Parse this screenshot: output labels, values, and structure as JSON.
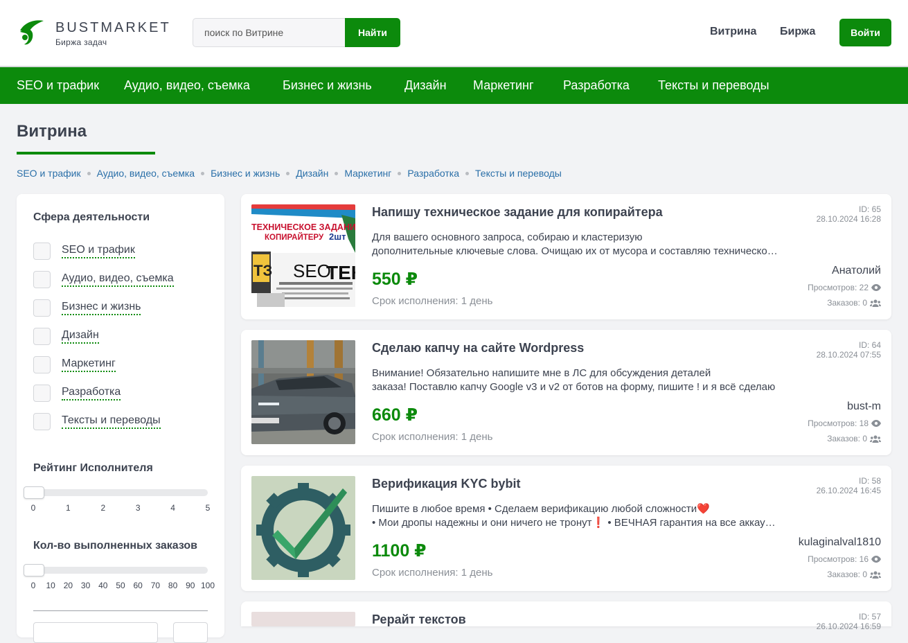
{
  "header": {
    "brand_name": "BUSTMARKET",
    "brand_sub": "Биржа задач",
    "search_placeholder": "поиск по Витрине",
    "search_button": "Найти",
    "links": [
      "Витрина",
      "Биржа"
    ],
    "login_button": "Войти"
  },
  "category_nav": [
    "SEO и трафик",
    "Аудио, видео, съемка",
    "Бизнес и жизнь",
    "Дизайн",
    "Маркетинг",
    "Разработка",
    "Тексты и переводы"
  ],
  "page_title": "Витрина",
  "breadcrumbs": [
    "SEO и трафик",
    "Аудио, видео, съемка",
    "Бизнес и жизнь",
    "Дизайн",
    "Маркетинг",
    "Разработка",
    "Тексты и переводы"
  ],
  "sidebar": {
    "sphere_heading": "Сфера деятельности",
    "categories": [
      "SEO и трафик",
      "Аудио, видео, съемка",
      "Бизнес и жизнь",
      "Дизайн",
      "Маркетинг",
      "Разработка",
      "Тексты и переводы"
    ],
    "rating_heading": "Рейтинг Исполнителя",
    "rating_ticks": [
      "0",
      "1",
      "2",
      "3",
      "4",
      "5"
    ],
    "rating_value": 0,
    "orders_heading": "Кол-во выполненных заказов",
    "orders_ticks": [
      "0",
      "10",
      "20",
      "30",
      "40",
      "50",
      "60",
      "70",
      "80",
      "90",
      "100"
    ],
    "orders_value": 0
  },
  "cards": [
    {
      "title": "Напишу техническое задание для копирайтера",
      "desc_line1": "Для вашего основного запроса, собираю и кластеризую",
      "desc_line2": "дополнительные ключевые слова. Очищаю их от мусора и составляю техническое задание",
      "price": "550 ₽",
      "term": "Срок исполнения: 1 день",
      "id": "ID: 65",
      "date": "28.10.2024 16:28",
      "author": "Анатолий",
      "views": "Просмотров: 22",
      "orders": "Заказов: 0",
      "image_text_1": "ТЕХНИЧЕСКОЕ ЗАДАНИЕ",
      "image_text_2": "КОПИРАЙТЕРУ",
      "image_text_3": "2шт",
      "image_text_4": "ТЗ",
      "image_text_5": "SEO",
      "image_text_6": "ТЕКС"
    },
    {
      "title": "Сделаю капчу на сайте Wordpress",
      "desc_line1": "Внимание! Обязательно напишите мне в ЛС для обсуждения деталей",
      "desc_line2": "заказа! Поставлю капчу Google v3 и v2 от ботов на форму, пишите ! и я всё сделаю",
      "price": "660 ₽",
      "term": "Срок исполнения: 1 день",
      "id": "ID: 64",
      "date": "28.10.2024 07:55",
      "author": "bust-m",
      "views": "Просмотров: 18",
      "orders": "Заказов: 0"
    },
    {
      "title": "Верификация KYC bybit",
      "desc_line1": "Пишите в любое время • Сделаем верификацию любой сложности❤️",
      "desc_line2": "• Мои дропы надежны и они ничего не тронут❗ • ВЕЧНАЯ гарантия на все аккаунты",
      "price": "1100 ₽",
      "term": "Срок исполнения: 1 день",
      "id": "ID: 58",
      "date": "26.10.2024 16:45",
      "author": "kulaginalval1810",
      "views": "Просмотров: 16",
      "orders": "Заказов: 0"
    },
    {
      "title": "Рерайт текстов",
      "id": "ID: 57",
      "date": "26.10.2024 16:59"
    }
  ],
  "colors": {
    "accent": "#0c8a0c",
    "link": "#2a6fa8",
    "text": "#3d4350",
    "muted": "#8a8f96"
  }
}
